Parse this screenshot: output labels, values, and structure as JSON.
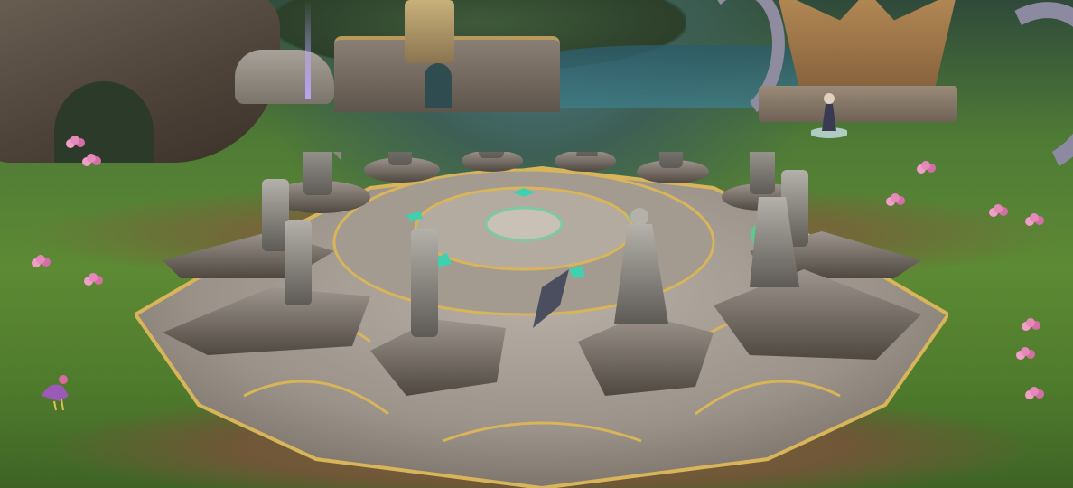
{
  "scene": {
    "kind": "game-world",
    "location": "statue circle",
    "palette": {
      "grass": "#5d8a34",
      "dirt": "#7a5f3a",
      "stone": "#9c948c",
      "gold_trim": "#d8b45a",
      "gem": "#3fd0b0",
      "flowers": "#e58ab8"
    }
  }
}
